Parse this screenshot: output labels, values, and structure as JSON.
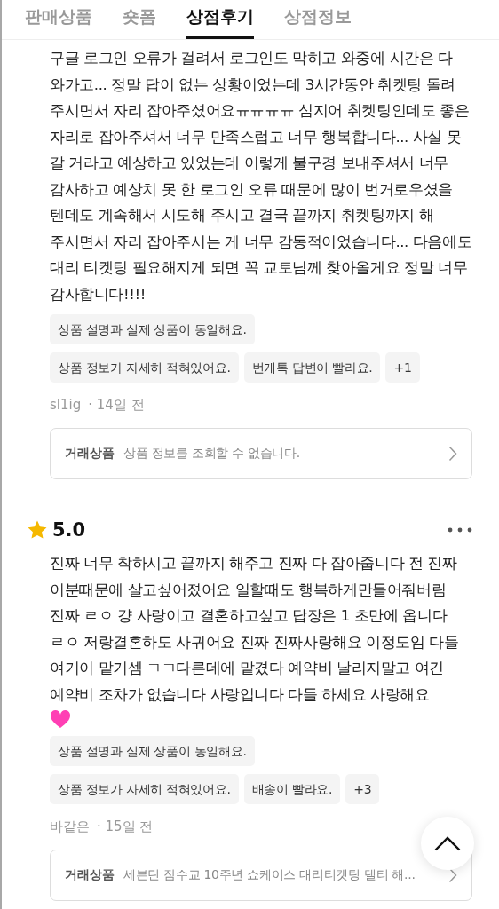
{
  "tabs": [
    {
      "label": "판매상품",
      "selected": false
    },
    {
      "label": "숏폼",
      "selected": false
    },
    {
      "label": "상점후기",
      "selected": true
    },
    {
      "label": "상점정보",
      "selected": false
    }
  ],
  "reviews": [
    {
      "body": "구글 로그인 오류가 걸려서 로그인도 막히고 와중에 시간은 다 와가고... 정말 답이 없는 상황이었는데 3시간동안 취켓팅 돌려 주시면서 자리 잡아주셨어요ㅠㅠㅠㅠ 심지어 취켓팅인데도 좋은 자리로 잡아주셔서 너무 만족스럽고 너무 행복합니다... 사실 못 갈 거라고 예상하고 있었는데 이렇게 불구경 보내주셔서 너무 감사하고 예상치 못 한 로그인 오류 때문에 많이 번거로우셨을 텐데도 계속해서 시도해 주시고 결국 끝까지 취켓팅까지 해 주시면서 자리 잡아주시는 게 너무 감동적이었습니다... 다음에도 대리 티켓팅 필요해지게 되면 꼭 교토님께 찾아올게요 정말 너무 감사합니다!!!!",
      "tag_rows": [
        [
          "상품 설명과 실제 상품이 동일해요."
        ],
        [
          "상품 정보가 자세히 적혀있어요.",
          "번개톡 답변이 빨라요.",
          "+1"
        ]
      ],
      "author": "sl1ig",
      "time": "· 14일 전",
      "product": {
        "label": "거래상품",
        "value": "상품 정보를 조회할 수 없습니다."
      }
    },
    {
      "rating": "5.0",
      "body": "진짜 너무 착하시고 끝까지 해주고 진짜 다 잡아줍니다 전 진짜 이분때문에 살고싶어졌어요 일할때도 행복하게만들어줘버림 진짜 ㄹㅇ 걍 사랑이고 결혼하고싶고 답장은 1 초만에 옵니다 ㄹㅇ 저랑결혼하도 사귀어요 진짜 진짜사랑해요 이정도임 다들 여기이 맡기셈 ㄱㄱ다른데에 맡겼다 예약비 날리지말고 여긴 예약비 조차가 없습니다 사랑입니다 다들 하세요 사랑해요",
      "tag_rows": [
        [
          "상품 설명과 실제 상품이 동일해요."
        ],
        [
          "상품 정보가 자세히 적혀있어요.",
          "배송이 빨라요.",
          "+3"
        ]
      ],
      "author": "바같은",
      "time": "· 15일 전",
      "product": {
        "label": "거래상품",
        "value": "세븐틴 잠수교 10주년 쇼케이스 대리티켓팅 댈티 해..."
      }
    }
  ]
}
